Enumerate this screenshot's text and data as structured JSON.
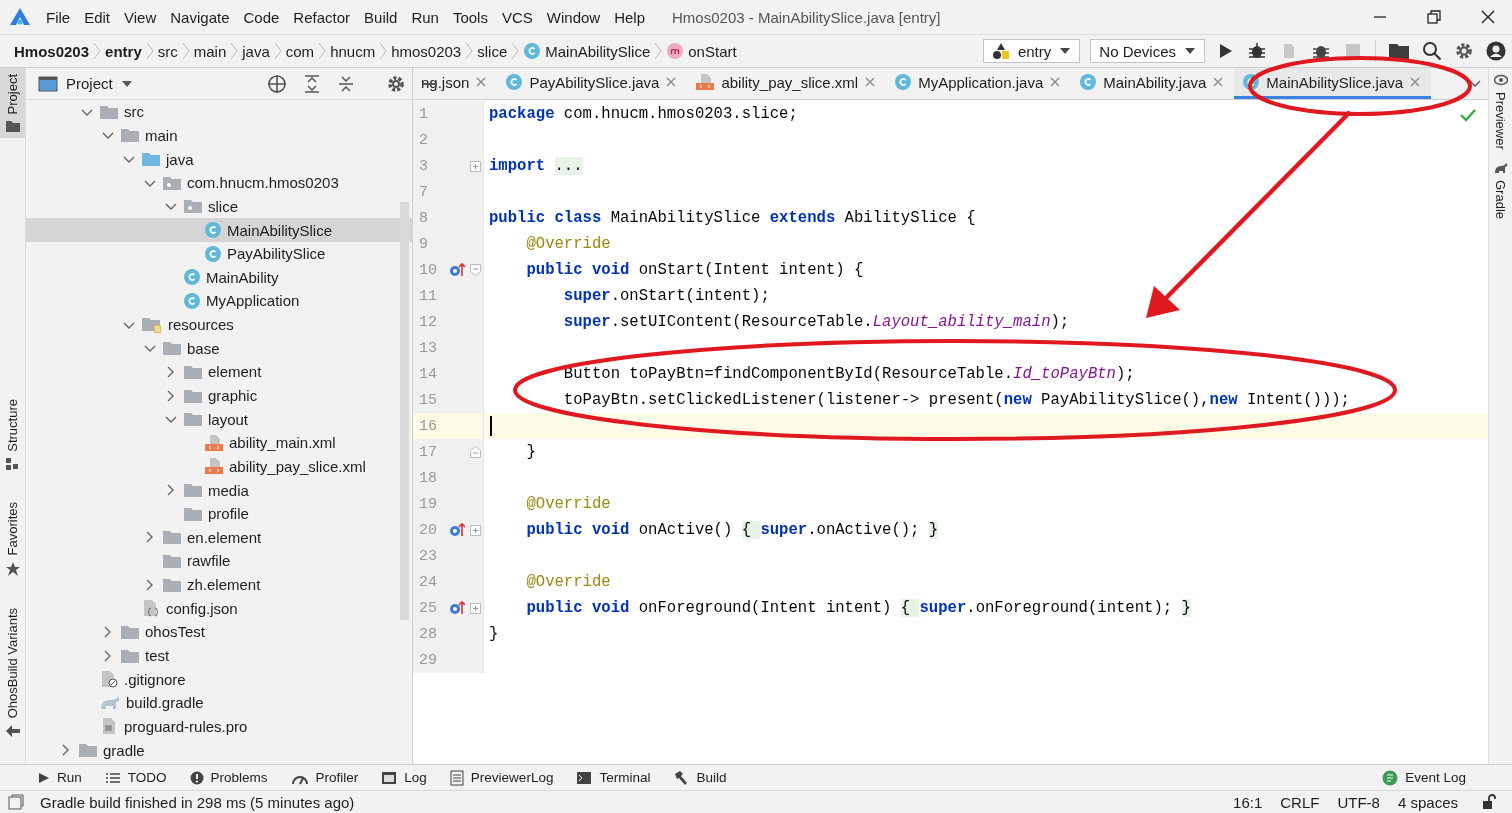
{
  "menu": {
    "items": [
      "File",
      "Edit",
      "View",
      "Navigate",
      "Code",
      "Refactor",
      "Build",
      "Run",
      "Tools",
      "VCS",
      "Window",
      "Help"
    ],
    "title": "Hmos0203 - MainAbilitySlice.java [entry]"
  },
  "breadcrumbs": [
    {
      "label": "Hmos0203",
      "bold": true
    },
    {
      "label": "entry",
      "bold": true
    },
    {
      "label": "src",
      "bold": false
    },
    {
      "label": "main",
      "bold": false
    },
    {
      "label": "java",
      "bold": false
    },
    {
      "label": "com",
      "bold": false
    },
    {
      "label": "hnucm",
      "bold": false
    },
    {
      "label": "hmos0203",
      "bold": false
    },
    {
      "label": "slice",
      "bold": false
    },
    {
      "label": "MainAbilitySlice",
      "bold": false,
      "kind": "class"
    },
    {
      "label": "onStart",
      "bold": false,
      "kind": "method"
    }
  ],
  "run_config": {
    "label": "entry"
  },
  "device": {
    "label": "No Devices"
  },
  "left_stripe": [
    {
      "label": "Project",
      "selected": true,
      "kind": "folder"
    },
    {
      "label": "Structure",
      "selected": false,
      "kind": "structure"
    },
    {
      "label": "Favorites",
      "selected": false,
      "kind": "star"
    },
    {
      "label": "OhosBuild Variants",
      "selected": false,
      "kind": "build"
    }
  ],
  "right_stripe": [
    {
      "label": "Previewer",
      "kind": "eye"
    },
    {
      "label": "Gradle",
      "kind": "gradle"
    }
  ],
  "project": {
    "title": "Project",
    "tree": [
      {
        "children": [
          {
            "label": "src",
            "kind": "folder",
            "expanded": true,
            "selected": false,
            "children": [
              {
                "label": "main",
                "kind": "folder",
                "expanded": true,
                "selected": false,
                "children": [
                  {
                    "label": "java",
                    "kind": "source-folder",
                    "expanded": true,
                    "selected": false,
                    "children": [
                      {
                        "label": "com.hnucm.hmos0203",
                        "kind": "package",
                        "expanded": true,
                        "selected": false,
                        "children": [
                          {
                            "label": "slice",
                            "kind": "package",
                            "expanded": true,
                            "selected": false,
                            "children": [
                              {
                                "label": "MainAbilitySlice",
                                "kind": "class",
                                "selected": true
                              },
                              {
                                "label": "PayAbilitySlice",
                                "kind": "class",
                                "selected": false
                              }
                            ]
                          },
                          {
                            "label": "MainAbility",
                            "kind": "class",
                            "selected": false
                          },
                          {
                            "label": "MyApplication",
                            "kind": "class",
                            "selected": false
                          }
                        ]
                      }
                    ]
                  },
                  {
                    "label": "resources",
                    "kind": "resources-folder",
                    "expanded": true,
                    "selected": false,
                    "children": [
                      {
                        "label": "base",
                        "kind": "folder",
                        "expanded": true,
                        "selected": false,
                        "children": [
                          {
                            "label": "element",
                            "kind": "folder",
                            "expanded": false,
                            "selected": false
                          },
                          {
                            "label": "graphic",
                            "kind": "folder",
                            "expanded": false,
                            "selected": false
                          },
                          {
                            "label": "layout",
                            "kind": "folder",
                            "expanded": true,
                            "selected": false,
                            "children": [
                              {
                                "label": "ability_main.xml",
                                "kind": "xml",
                                "selected": false
                              },
                              {
                                "label": "ability_pay_slice.xml",
                                "kind": "xml",
                                "selected": false
                              }
                            ]
                          },
                          {
                            "label": "media",
                            "kind": "folder",
                            "expanded": false,
                            "selected": false
                          },
                          {
                            "label": "profile",
                            "kind": "folder",
                            "selected": false
                          }
                        ]
                      },
                      {
                        "label": "en.element",
                        "kind": "folder",
                        "expanded": false,
                        "selected": false
                      },
                      {
                        "label": "rawfile",
                        "kind": "folder",
                        "selected": false
                      },
                      {
                        "label": "zh.element",
                        "kind": "folder",
                        "expanded": false,
                        "selected": false
                      }
                    ]
                  },
                  {
                    "label": "config.json",
                    "kind": "json",
                    "selected": false
                  }
                ]
              },
              {
                "label": "ohosTest",
                "kind": "folder",
                "expanded": false,
                "selected": false
              },
              {
                "label": "test",
                "kind": "folder",
                "expanded": false,
                "selected": false
              }
            ]
          },
          {
            "label": ".gitignore",
            "kind": "ignore",
            "selected": false
          },
          {
            "label": "build.gradle",
            "kind": "gradle",
            "selected": false
          },
          {
            "label": "proguard-rules.pro",
            "kind": "text",
            "selected": false
          }
        ]
      },
      {
        "label": "gradle",
        "kind": "folder",
        "expanded": false,
        "selected": false
      }
    ]
  },
  "tabs": [
    {
      "label": "ng.json",
      "selected": false
    },
    {
      "label": "PayAbilitySlice.java",
      "kind": "class",
      "selected": false
    },
    {
      "label": "ability_pay_slice.xml",
      "kind": "xml",
      "selected": false
    },
    {
      "label": "MyApplication.java",
      "kind": "class",
      "selected": false
    },
    {
      "label": "MainAbility.java",
      "kind": "class",
      "selected": false
    },
    {
      "label": "MainAbilitySlice.java",
      "kind": "class",
      "selected": true
    }
  ],
  "editor": {
    "lines": [
      {
        "num": "1",
        "current": false,
        "segments": [
          {
            "text": "package",
            "kind": "kw"
          },
          {
            "text": " com.hnucm.hmos0203.slice;",
            "kind": "plain"
          }
        ]
      },
      {
        "num": "2",
        "current": false
      },
      {
        "num": "3",
        "current": false,
        "gutter_icons": [
          {
            "kind": "fold-collapsed"
          }
        ],
        "segments": [
          {
            "text": "import ",
            "kind": "kw"
          },
          {
            "text": "...",
            "kind": "folded"
          }
        ]
      },
      {
        "num": "7",
        "current": false
      },
      {
        "num": "8",
        "current": false,
        "segments": [
          {
            "text": "public class",
            "kind": "kw"
          },
          {
            "text": " MainAbilitySlice ",
            "kind": "plain"
          },
          {
            "text": "extends",
            "kind": "kw"
          },
          {
            "text": " AbilitySlice {",
            "kind": "plain"
          }
        ]
      },
      {
        "num": "9",
        "current": false,
        "segments": [
          {
            "text": "    @Override",
            "kind": "annotation"
          }
        ]
      },
      {
        "num": "10",
        "current": false,
        "gutter_icons": [
          {
            "kind": "override"
          },
          {
            "kind": "fold-open"
          }
        ],
        "segments": [
          {
            "text": "    public void",
            "kind": "kw"
          },
          {
            "text": " onStart(Intent intent) {",
            "kind": "plain"
          }
        ]
      },
      {
        "num": "11",
        "current": false,
        "segments": [
          {
            "text": "        super",
            "kind": "kw"
          },
          {
            "text": ".onStart(intent);",
            "kind": "plain"
          }
        ]
      },
      {
        "num": "12",
        "current": false,
        "segments": [
          {
            "text": "        super",
            "kind": "kw"
          },
          {
            "text": ".setUIContent(ResourceTable.",
            "kind": "plain"
          },
          {
            "text": "Layout_ability_main",
            "kind": "field"
          },
          {
            "text": ");",
            "kind": "plain"
          }
        ]
      },
      {
        "num": "13",
        "current": false
      },
      {
        "num": "14",
        "current": false,
        "segments": [
          {
            "text": "        Button toPayBtn=findComponentById(ResourceTable.",
            "kind": "plain"
          },
          {
            "text": "Id_toPayBtn",
            "kind": "field"
          },
          {
            "text": ");",
            "kind": "plain"
          }
        ]
      },
      {
        "num": "15",
        "current": false,
        "segments": [
          {
            "text": "        toPayBtn.setClickedListener(listener-> present(",
            "kind": "plain"
          },
          {
            "text": "new",
            "kind": "kw"
          },
          {
            "text": " PayAbilitySlice(),",
            "kind": "plain"
          },
          {
            "text": "new",
            "kind": "kw"
          },
          {
            "text": " Intent()));",
            "kind": "plain"
          }
        ]
      },
      {
        "num": "16",
        "current": true
      },
      {
        "num": "17",
        "current": false,
        "gutter_icons": [
          {
            "kind": "fold-close"
          }
        ],
        "segments": [
          {
            "text": "    }",
            "kind": "plain"
          }
        ]
      },
      {
        "num": "18",
        "current": false
      },
      {
        "num": "19",
        "current": false,
        "segments": [
          {
            "text": "    @Override",
            "kind": "annotation"
          }
        ]
      },
      {
        "num": "20",
        "current": false,
        "gutter_icons": [
          {
            "kind": "override"
          },
          {
            "kind": "fold-collapsed"
          }
        ],
        "segments": [
          {
            "text": "    public void",
            "kind": "kw"
          },
          {
            "text": " onActive() ",
            "kind": "plain"
          },
          {
            "text": "{ ",
            "kind": "folded"
          },
          {
            "text": "super",
            "kind": "kw"
          },
          {
            "text": ".onActive(); ",
            "kind": "plain"
          },
          {
            "text": "}",
            "kind": "folded"
          }
        ]
      },
      {
        "num": "23",
        "current": false
      },
      {
        "num": "24",
        "current": false,
        "segments": [
          {
            "text": "    @Override",
            "kind": "annotation"
          }
        ]
      },
      {
        "num": "25",
        "current": false,
        "gutter_icons": [
          {
            "kind": "override"
          },
          {
            "kind": "fold-collapsed"
          }
        ],
        "segments": [
          {
            "text": "    public void",
            "kind": "kw"
          },
          {
            "text": " onForeground(Intent intent) ",
            "kind": "plain"
          },
          {
            "text": "{ ",
            "kind": "folded"
          },
          {
            "text": "super",
            "kind": "kw"
          },
          {
            "text": ".onForeground(intent); ",
            "kind": "plain"
          },
          {
            "text": "}",
            "kind": "folded"
          }
        ]
      },
      {
        "num": "28",
        "current": false,
        "segments": [
          {
            "text": "}",
            "kind": "plain"
          }
        ]
      },
      {
        "num": "29",
        "current": false
      }
    ]
  },
  "annotations": [
    {
      "kind": "ellipse"
    },
    {
      "kind": "ellipse"
    },
    {
      "kind": "arrow"
    }
  ],
  "tool_windows": [
    {
      "label": "Run",
      "kind": "run"
    },
    {
      "label": "TODO",
      "kind": "list"
    },
    {
      "label": "Problems",
      "kind": "problems"
    },
    {
      "label": "Profiler",
      "kind": "gauge"
    },
    {
      "label": "Log",
      "kind": "log"
    },
    {
      "label": "PreviewerLog",
      "kind": "doc"
    },
    {
      "label": "Terminal",
      "kind": "terminal"
    },
    {
      "label": "Build",
      "kind": "hammer"
    }
  ],
  "event_log": {
    "label": "Event Log"
  },
  "status": {
    "message": "Gradle build finished in 298 ms (5 minutes ago)",
    "items": [
      "16:1",
      "CRLF",
      "UTF-8",
      "4 spaces"
    ]
  }
}
